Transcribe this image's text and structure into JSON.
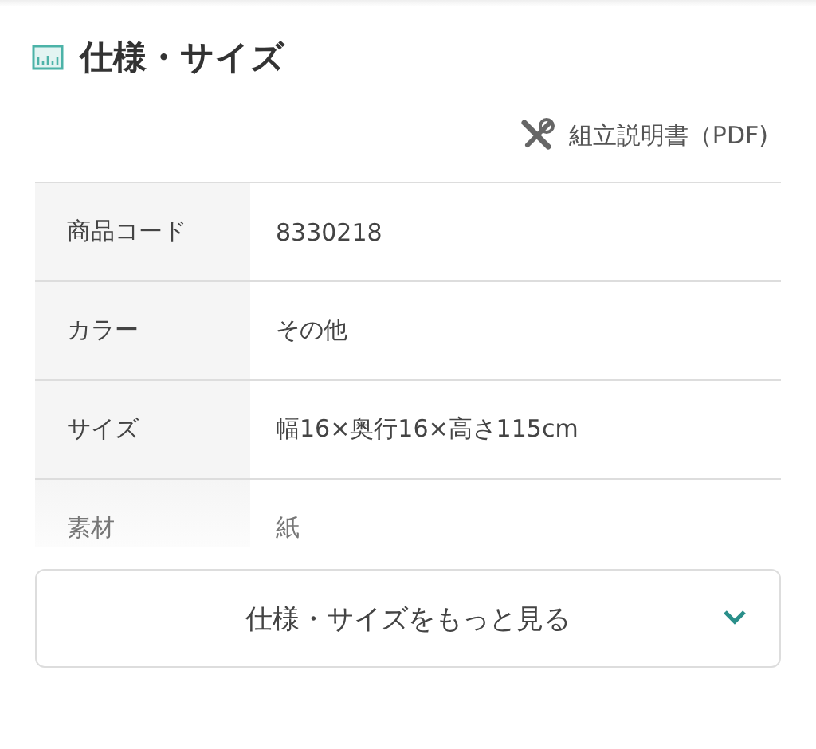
{
  "heading": {
    "title": "仕様・サイズ"
  },
  "manual_link": {
    "label": "組立説明書（PDF)"
  },
  "specs": [
    {
      "label": "商品コード",
      "value": "8330218"
    },
    {
      "label": "カラー",
      "value": "その他"
    },
    {
      "label": "サイズ",
      "value": "幅16×奥行16×高さ115cm"
    },
    {
      "label": "素材",
      "value": "紙"
    }
  ],
  "more_button": {
    "label": "仕様・サイズをもっと見る"
  }
}
